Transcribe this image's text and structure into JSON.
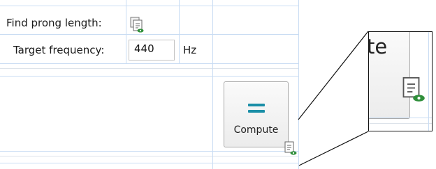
{
  "form": {
    "find_prong_length_label": "Find prong length:",
    "target_frequency_label": "Target frequency:",
    "target_frequency_value": "440",
    "target_frequency_unit": "Hz"
  },
  "compute_button": {
    "label": "Compute",
    "icon": "equals-icon"
  },
  "zoom_inset": {
    "visible_text": "te"
  },
  "colors": {
    "grid_line": "#c9dcf3",
    "accent_teal": "#1a8ea7",
    "eye_green": "#2f8f3a"
  }
}
